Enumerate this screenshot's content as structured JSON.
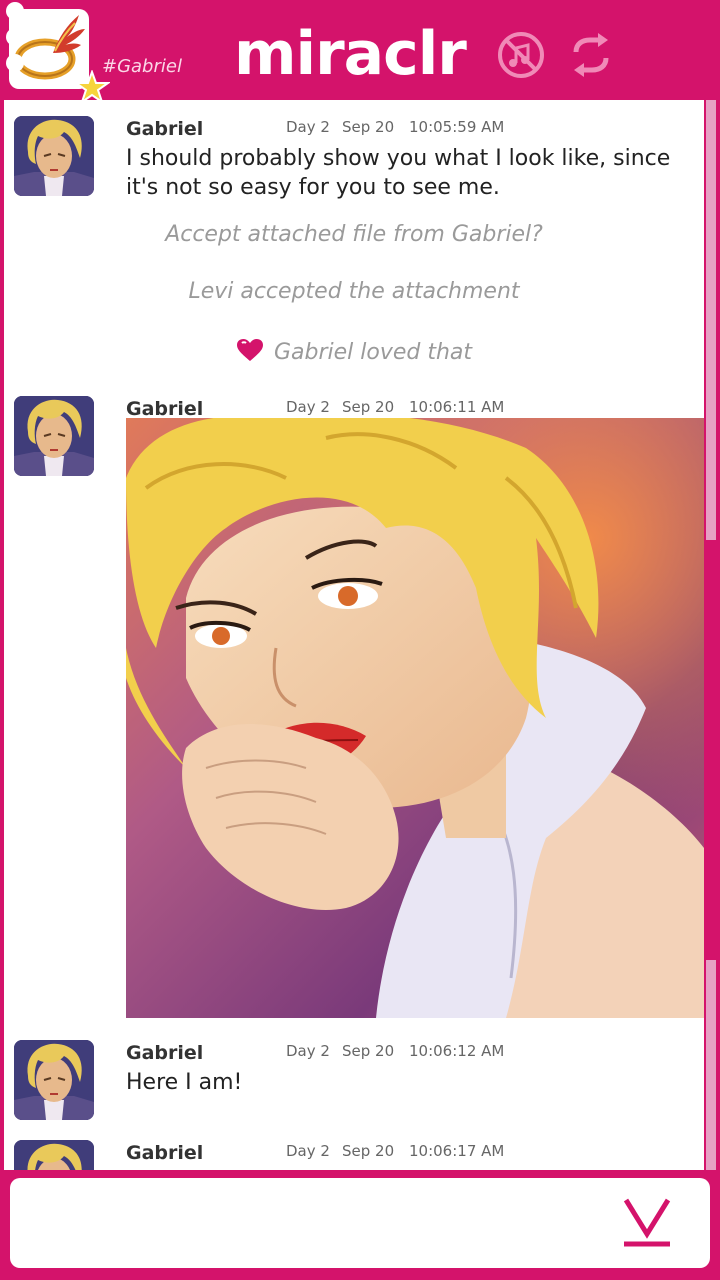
{
  "header": {
    "app_title": "miraclr",
    "channel": "#Gabriel",
    "icons": [
      "app-logo-icon",
      "music-muted-icon",
      "sync-icon",
      "menu-dots-icon"
    ]
  },
  "messages": [
    {
      "sender": "Gabriel",
      "day": "Day 2",
      "date": "Sep 20",
      "time": "10:05:59 AM",
      "text": "I should probably show you what I look like, since it's not so easy for you to see me."
    },
    {
      "sender": "Gabriel",
      "day": "Day 2",
      "date": "Sep 20",
      "time": "10:06:11 AM",
      "attachment": "portrait-image"
    },
    {
      "sender": "Gabriel",
      "day": "Day 2",
      "date": "Sep 20",
      "time": "10:06:12 AM",
      "text": "Here I am!"
    },
    {
      "sender": "Gabriel",
      "day": "Day 2",
      "date": "Sep 20",
      "time": "10:06:17 AM"
    }
  ],
  "system": {
    "accept_prompt": "Accept attached file from Gabriel?",
    "accepted": "Levi accepted the attachment",
    "loved": "Gabriel loved that"
  },
  "colors": {
    "brand": "#d4136b",
    "scroll_track": "#e6a0c4",
    "muted_text": "#9a9a9a"
  }
}
